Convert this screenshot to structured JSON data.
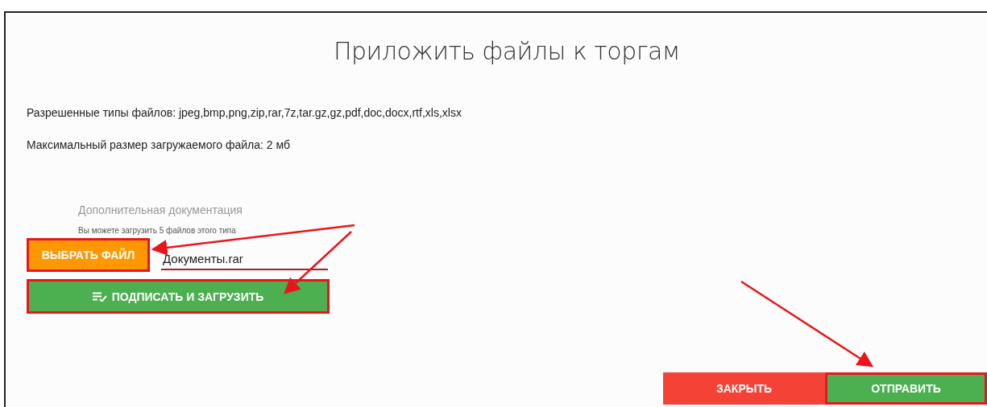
{
  "dialog": {
    "title": "Приложить файлы к торгам",
    "info": [
      "Разрешенные типы файлов: jpeg,bmp,png,zip,rar,7z,tar.gz,gz,pdf,doc,docx,rtf,xls,xlsx",
      "Максимальный размер загружаемого файла: 2 мб"
    ],
    "upload": {
      "label": "Дополнительная документация",
      "hint": "Вы можете загрузить 5 файлов этого типа",
      "choose_button": {
        "label": "ВЫБРАТЬ ФАЙЛ",
        "highlighted": true
      },
      "file_name": {
        "value": "Документы.rar",
        "highlighted": true
      },
      "sign_button": {
        "label": "ПОДПИСАТЬ И ЗАГРУЗИТЬ",
        "highlighted": true
      }
    },
    "buttons": [
      {
        "label": "ЗАКРЫТЬ",
        "kind": "close",
        "highlighted": false
      },
      {
        "label": "ОТПРАВИТЬ",
        "kind": "submit",
        "highlighted": true
      }
    ]
  }
}
